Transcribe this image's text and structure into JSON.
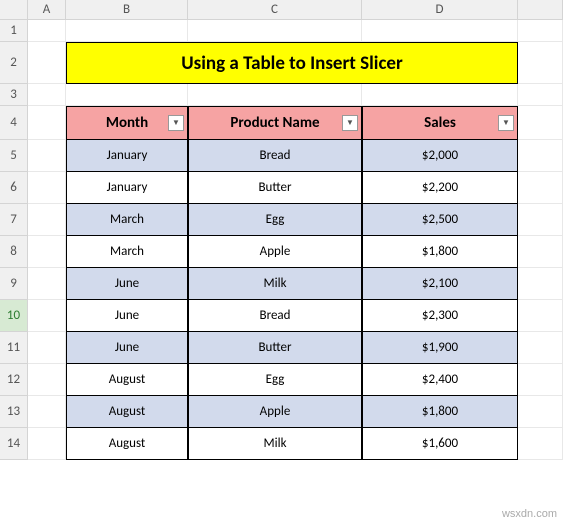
{
  "columns": [
    "A",
    "B",
    "C",
    "D"
  ],
  "rows": [
    "1",
    "2",
    "3",
    "4",
    "5",
    "6",
    "7",
    "8",
    "9",
    "10",
    "11",
    "12",
    "13",
    "14"
  ],
  "selected_row": "10",
  "title": "Using a Table to Insert Slicer",
  "headers": {
    "month": "Month",
    "product": "Product Name",
    "sales": "Sales"
  },
  "chart_data": {
    "type": "table",
    "columns": [
      "Month",
      "Product Name",
      "Sales"
    ],
    "rows": [
      {
        "month": "January",
        "product": "Bread",
        "sales": "$2,000"
      },
      {
        "month": "January",
        "product": "Butter",
        "sales": "$2,200"
      },
      {
        "month": "March",
        "product": "Egg",
        "sales": "$2,500"
      },
      {
        "month": "March",
        "product": "Apple",
        "sales": "$1,800"
      },
      {
        "month": "June",
        "product": "Milk",
        "sales": "$2,100"
      },
      {
        "month": "June",
        "product": "Bread",
        "sales": "$2,300"
      },
      {
        "month": "June",
        "product": "Butter",
        "sales": "$1,900"
      },
      {
        "month": "August",
        "product": "Egg",
        "sales": "$2,400"
      },
      {
        "month": "August",
        "product": "Apple",
        "sales": "$1,800"
      },
      {
        "month": "August",
        "product": "Milk",
        "sales": "$1,600"
      }
    ]
  },
  "watermark": "wsxdn.com"
}
